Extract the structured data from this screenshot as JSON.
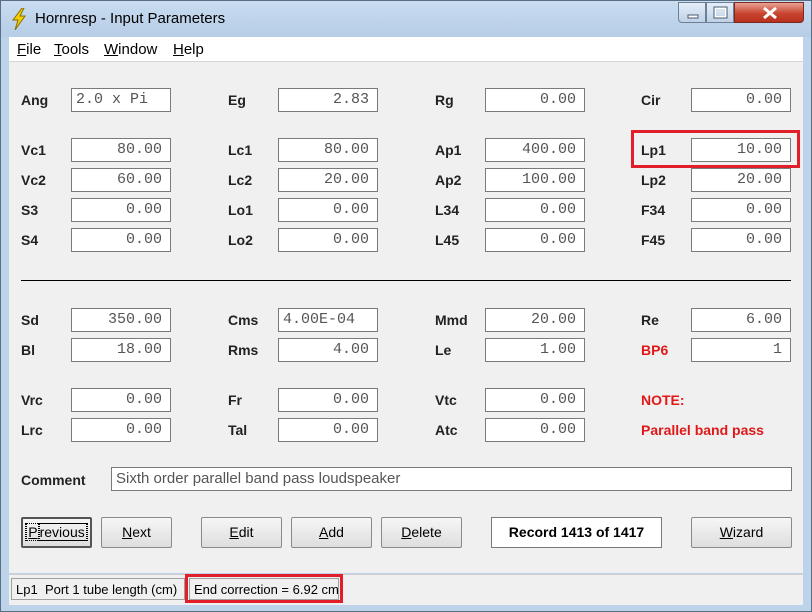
{
  "window": {
    "title": "Hornresp - Input Parameters"
  },
  "menu": [
    {
      "label": "File",
      "accel": "F",
      "rest": "ile"
    },
    {
      "label": "Tools",
      "accel": "T",
      "rest": "ools"
    },
    {
      "label": "Window",
      "accel": "W",
      "rest": "indow"
    },
    {
      "label": "Help",
      "accel": "H",
      "rest": "elp"
    }
  ],
  "params": {
    "ang": {
      "label": "Ang",
      "value": "2.0 x Pi"
    },
    "eg": {
      "label": "Eg",
      "value": "2.83"
    },
    "rg": {
      "label": "Rg",
      "value": "0.00"
    },
    "cir": {
      "label": "Cir",
      "value": "0.00"
    },
    "vc1": {
      "label": "Vc1",
      "value": "80.00"
    },
    "lc1": {
      "label": "Lc1",
      "value": "80.00"
    },
    "ap1": {
      "label": "Ap1",
      "value": "400.00"
    },
    "lp1": {
      "label": "Lp1",
      "value": "10.00"
    },
    "vc2": {
      "label": "Vc2",
      "value": "60.00"
    },
    "lc2": {
      "label": "Lc2",
      "value": "20.00"
    },
    "ap2": {
      "label": "Ap2",
      "value": "100.00"
    },
    "lp2": {
      "label": "Lp2",
      "value": "20.00"
    },
    "s3": {
      "label": "S3",
      "value": "0.00"
    },
    "lo1": {
      "label": "Lo1",
      "value": "0.00"
    },
    "l34": {
      "label": "L34",
      "value": "0.00"
    },
    "f34": {
      "label": "F34",
      "value": "0.00"
    },
    "s4": {
      "label": "S4",
      "value": "0.00"
    },
    "lo2": {
      "label": "Lo2",
      "value": "0.00"
    },
    "l45": {
      "label": "L45",
      "value": "0.00"
    },
    "f45": {
      "label": "F45",
      "value": "0.00"
    },
    "sd": {
      "label": "Sd",
      "value": "350.00"
    },
    "cms": {
      "label": "Cms",
      "value": "4.00E-04"
    },
    "mmd": {
      "label": "Mmd",
      "value": "20.00"
    },
    "re": {
      "label": "Re",
      "value": "6.00"
    },
    "bl": {
      "label": "Bl",
      "value": "18.00"
    },
    "rms": {
      "label": "Rms",
      "value": "4.00"
    },
    "le": {
      "label": "Le",
      "value": "1.00"
    },
    "bp6": {
      "label": "BP6",
      "value": "1"
    },
    "vrc": {
      "label": "Vrc",
      "value": "0.00"
    },
    "fr": {
      "label": "Fr",
      "value": "0.00"
    },
    "vtc": {
      "label": "Vtc",
      "value": "0.00"
    },
    "lrc": {
      "label": "Lrc",
      "value": "0.00"
    },
    "tal": {
      "label": "Tal",
      "value": "0.00"
    },
    "atc": {
      "label": "Atc",
      "value": "0.00"
    }
  },
  "note": {
    "title": "NOTE:",
    "text": "Parallel band pass"
  },
  "comment": {
    "label": "Comment",
    "value": "Sixth order parallel band pass loudspeaker"
  },
  "buttons": {
    "previous": {
      "accel": "P",
      "rest": "revious"
    },
    "next": {
      "accel": "N",
      "rest": "ext"
    },
    "edit": {
      "accel": "E",
      "rest": "dit"
    },
    "add": {
      "accel": "A",
      "rest": "dd"
    },
    "delete": {
      "accel": "D",
      "rest": "elete"
    },
    "wizard": {
      "accel": "W",
      "rest": "izard"
    }
  },
  "record": "Record 1413 of 1417",
  "status": {
    "field": "Lp1",
    "description": "Port 1 tube length  (cm)",
    "end_correction": "End correction = 6.92 cm"
  },
  "colors": {
    "highlight": "#e01f2a",
    "note_red": "#e01818",
    "titlebar": "#bcd3ea"
  }
}
